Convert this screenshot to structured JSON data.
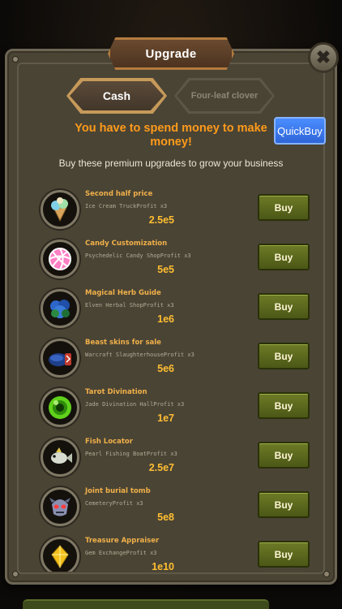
{
  "header": {
    "title": "Upgrade",
    "close_icon": "close-icon"
  },
  "tabs": [
    {
      "label": "Cash",
      "active": true
    },
    {
      "label": "Four-leaf clover",
      "active": false
    }
  ],
  "promo": {
    "headline": "You have to spend money to make money!",
    "quickbuy_label": "QuickBuy",
    "subtitle": "Buy these premium upgrades to grow your business"
  },
  "upgrades": [
    {
      "name": "Second half price",
      "desc": "Ice Cream TruckProfit x3",
      "price": "2.5e5",
      "button": "Buy",
      "icon": "ice-cream-icon"
    },
    {
      "name": "Candy Customization",
      "desc": "Psychedelic Candy ShopProfit x3",
      "price": "5e5",
      "button": "Buy",
      "icon": "candy-icon"
    },
    {
      "name": "Magical Herb Guide",
      "desc": "Elven Herbal ShopProfit x3",
      "price": "1e6",
      "button": "Buy",
      "icon": "herb-icon"
    },
    {
      "name": "Beast skins for sale",
      "desc": "Warcraft SlaughterhouseProfit x3",
      "price": "5e6",
      "button": "Buy",
      "icon": "beast-skin-icon"
    },
    {
      "name": "Tarot Divination",
      "desc": "Jade Divination HallProfit x3",
      "price": "1e7",
      "button": "Buy",
      "icon": "jade-orb-icon"
    },
    {
      "name": "Fish Locator",
      "desc": "Pearl Fishing BoatProfit x3",
      "price": "2.5e7",
      "button": "Buy",
      "icon": "fish-icon"
    },
    {
      "name": "Joint burial tomb",
      "desc": "CemeteryProfit x3",
      "price": "5e8",
      "button": "Buy",
      "icon": "skull-mask-icon"
    },
    {
      "name": "Treasure Appraiser",
      "desc": "Gem ExchangeProfit x3",
      "price": "1e10",
      "button": "Buy",
      "icon": "gem-icon"
    }
  ],
  "colors": {
    "panel": "#4a4435",
    "accent_orange": "#ff9b1a",
    "price_gold": "#ffbe31",
    "buy_green": "#5c6a1e",
    "quickbuy_blue": "#3b77ee"
  }
}
